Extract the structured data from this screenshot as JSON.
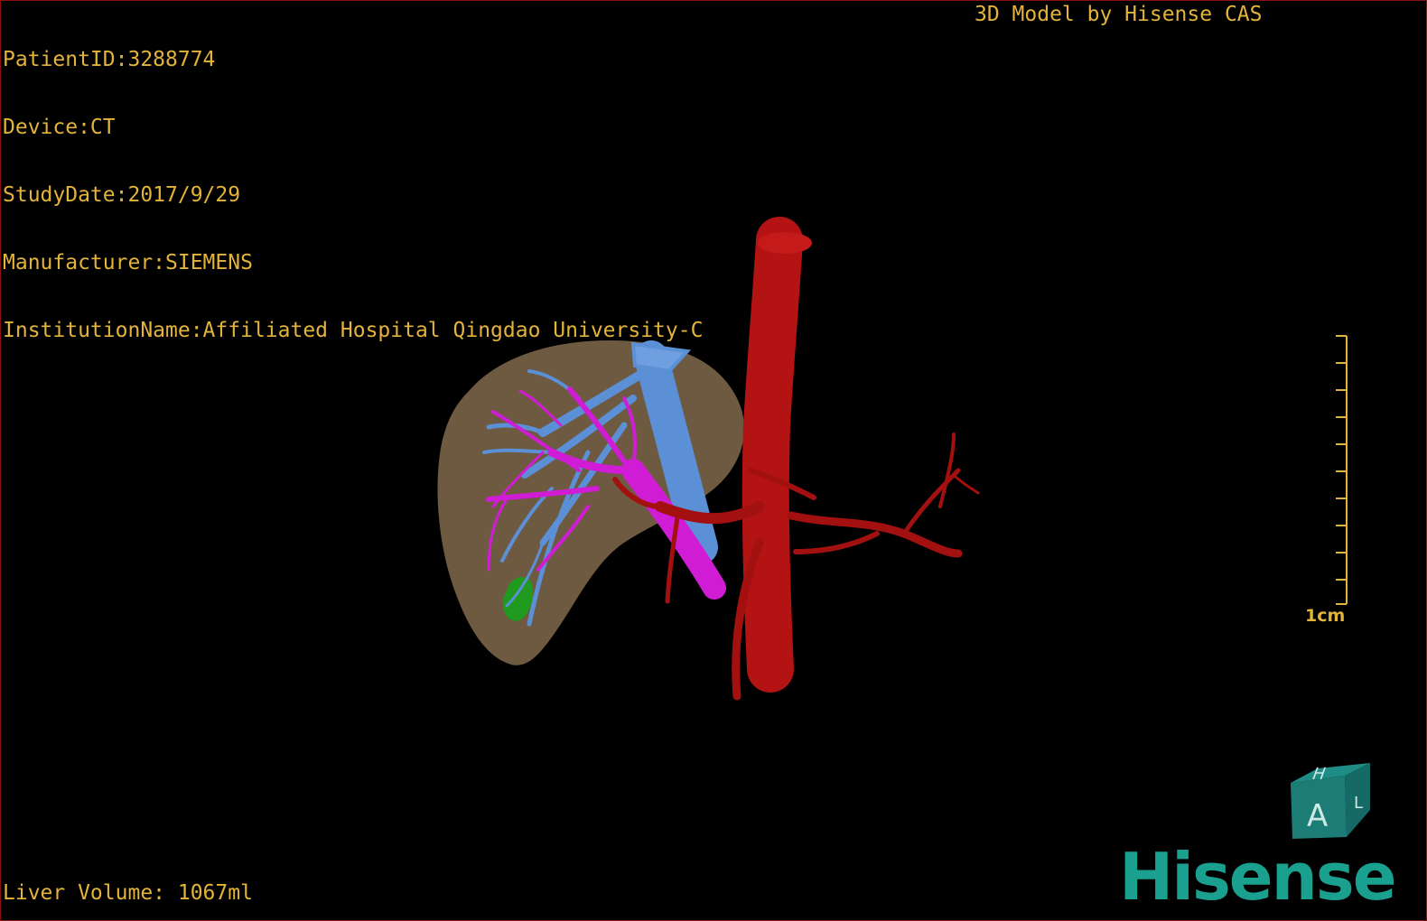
{
  "overlay": {
    "patient_id": "PatientID:3288774",
    "device": "Device:CT",
    "study_date": "StudyDate:2017/9/29",
    "manufacturer": "Manufacturer:SIEMENS",
    "institution": "InstitutionName:Affiliated Hospital Qingdao University-C",
    "credit": "3D Model by Hisense CAS",
    "liver_volume": "Liver Volume: 1067ml"
  },
  "scale_bar": {
    "label": "1cm"
  },
  "orientation_cube": {
    "front_face": "A",
    "top_face": "H",
    "side_face": "L"
  },
  "brand": {
    "logo_text": "Hisense"
  },
  "colors": {
    "overlay_text": "#e3b33a",
    "liver": "#8a7150",
    "hepatic_vein": "#5b8fd6",
    "portal_vein": "#d01cd4",
    "artery_aorta": "#b31313",
    "lesion": "#1f9a1f",
    "logo": "#1aa08f"
  },
  "icons": [
    "orientation-cube-icon",
    "hisense-logo-icon",
    "scale-bar-icon"
  ]
}
